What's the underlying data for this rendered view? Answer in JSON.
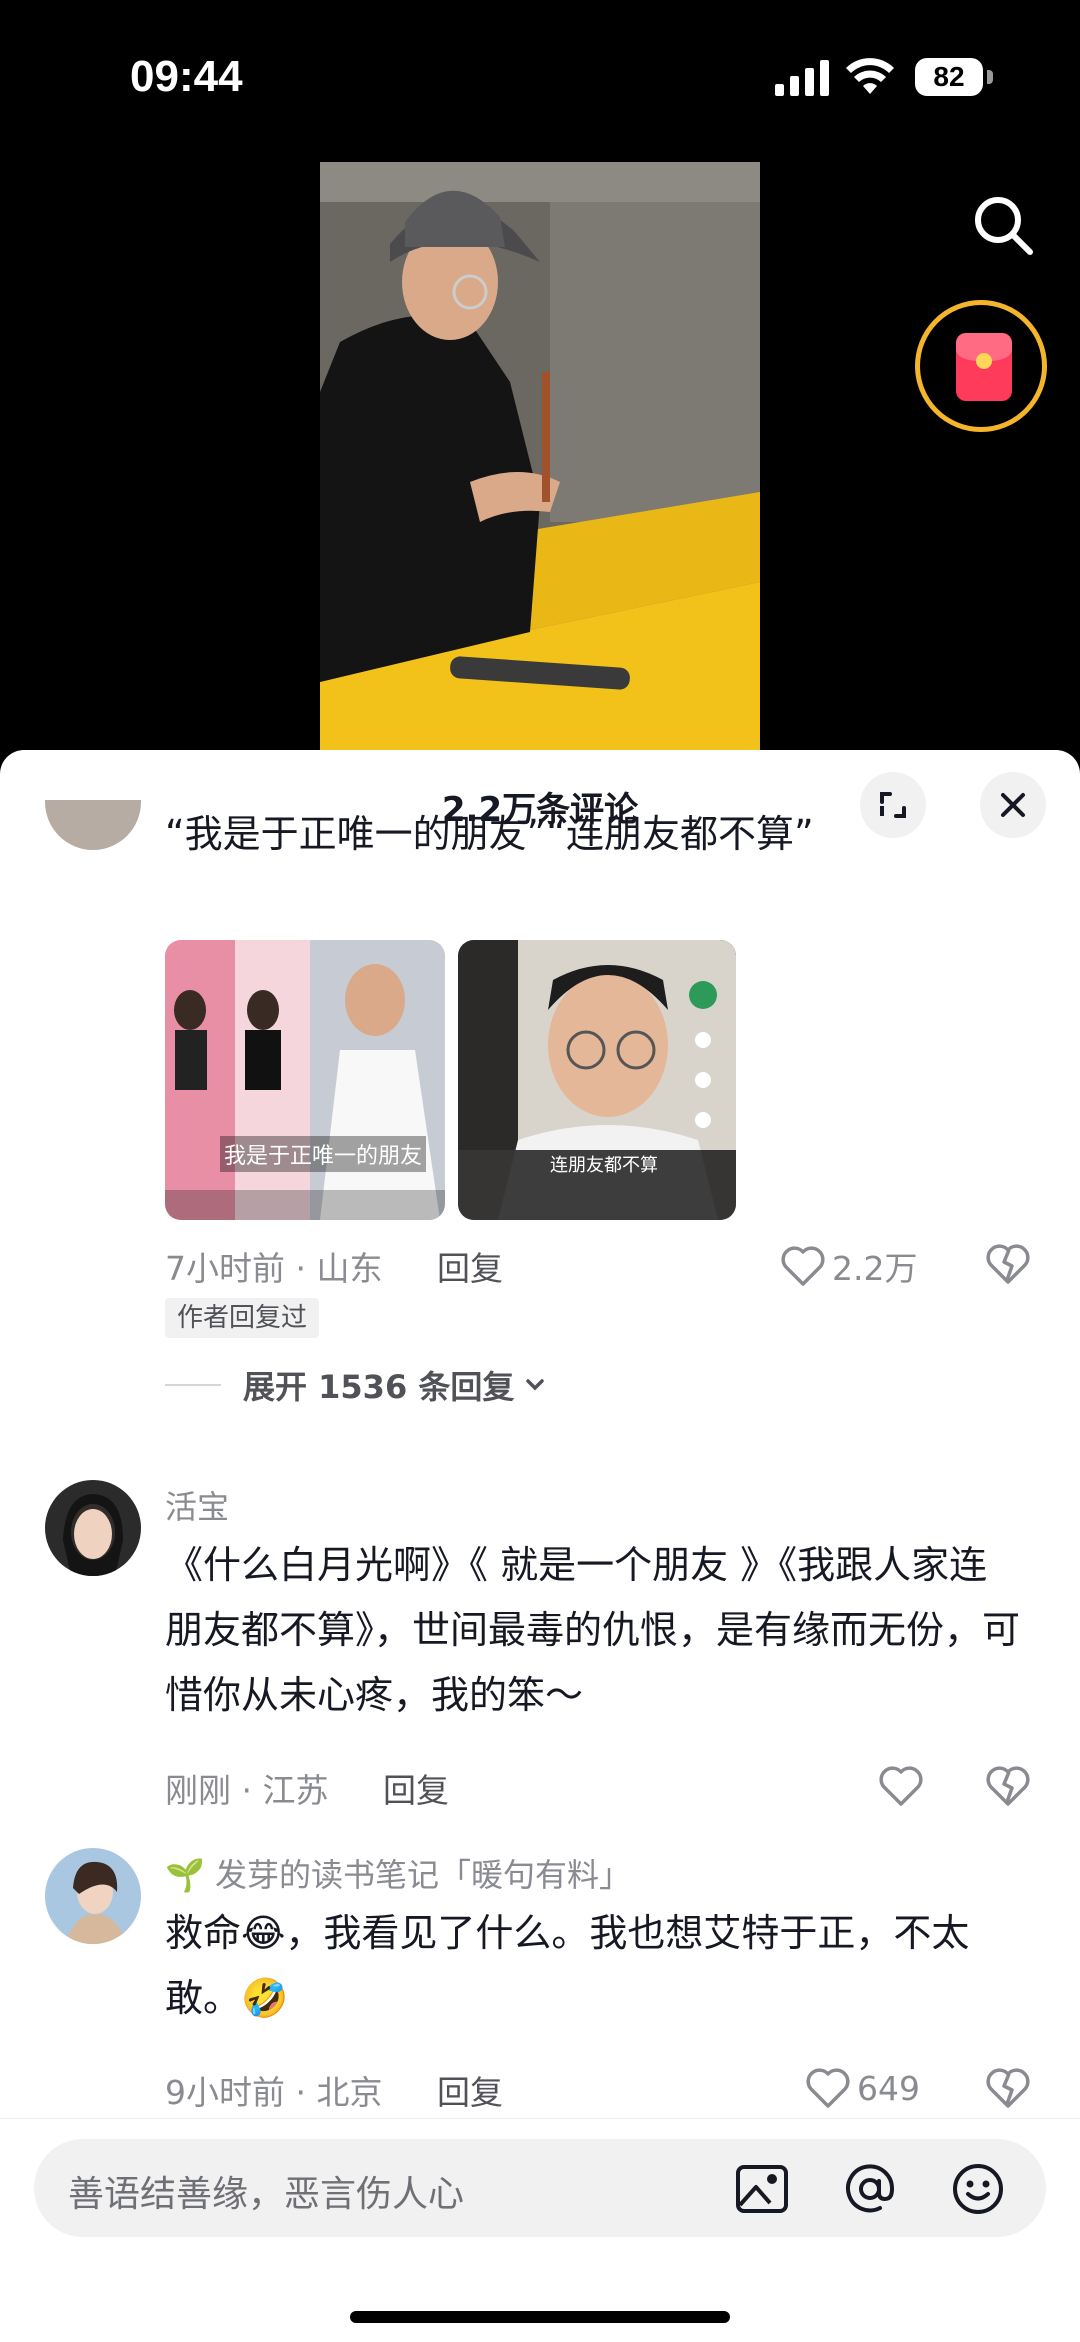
{
  "status": {
    "time": "09:44",
    "battery": "82"
  },
  "sheet": {
    "title": "2.2万条评论"
  },
  "comments": [
    {
      "text": "“我是于正唯一的朋友”“连朋友都不算”",
      "images": [
        "我是于正唯一的朋友",
        "连朋友都不算"
      ],
      "meta": "7小时前 · 山东",
      "reply": "回复",
      "likes": "2.2万",
      "author_tag": "作者回复过",
      "expand": "展开 1536 条回复"
    },
    {
      "user": "活宝",
      "text": "《什么白月光啊》《 就是一个朋友 》《我跟人家连朋友都不算》，世间最毒的仇恨，是有缘而无份，可惜你从未心疼，我的笨～",
      "meta": "刚刚 · 江苏",
      "reply": "回复",
      "likes": ""
    },
    {
      "user": "🌱 发芽的读书笔记「暖句有料」",
      "text": "救命😂，我看见了什么。我也想艾特于正，不太敢。🤣",
      "meta": "9小时前 · 北京",
      "reply": "回复",
      "likes": "649"
    }
  ],
  "input": {
    "placeholder": "善语结善缘，恶言伤人心"
  },
  "icons": [
    "search-icon",
    "red-packet-icon",
    "expand-icon",
    "close-icon",
    "heart-icon",
    "broken-heart-icon",
    "image-icon",
    "at-icon",
    "emoji-icon"
  ]
}
